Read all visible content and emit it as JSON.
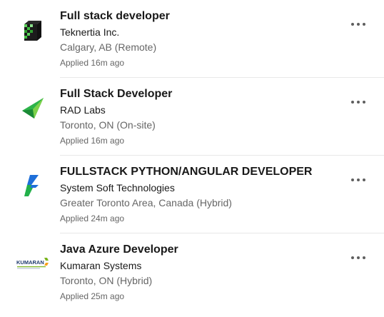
{
  "jobs": [
    {
      "logo_icon": "teknertia-logo-icon",
      "title": "Full stack developer",
      "company": "Teknertia Inc.",
      "location": "Calgary, AB (Remote)",
      "applied": "Applied 16m ago",
      "more_icon": "more-horizontal-icon"
    },
    {
      "logo_icon": "rad-labs-logo-icon",
      "title": "Full Stack Developer",
      "company": "RAD Labs",
      "location": "Toronto, ON (On-site)",
      "applied": "Applied 16m ago",
      "more_icon": "more-horizontal-icon"
    },
    {
      "logo_icon": "system-soft-logo-icon",
      "title": "FULLSTACK PYTHON/ANGULAR DEVELOPER",
      "company": "System Soft Technologies",
      "location": "Greater Toronto Area, Canada (Hybrid)",
      "applied": "Applied 24m ago",
      "more_icon": "more-horizontal-icon"
    },
    {
      "logo_icon": "kumaran-logo-icon",
      "logo_text": "KUMARAN",
      "title": "Java Azure Developer",
      "company": "Kumaran Systems",
      "location": "Toronto, ON (Hybrid)",
      "applied": "Applied 25m ago",
      "more_icon": "more-horizontal-icon"
    }
  ],
  "colors": {
    "title": "#191919",
    "secondary_text": "#666666",
    "divider": "#e8e8e8",
    "icon": "#5e5e5e"
  }
}
